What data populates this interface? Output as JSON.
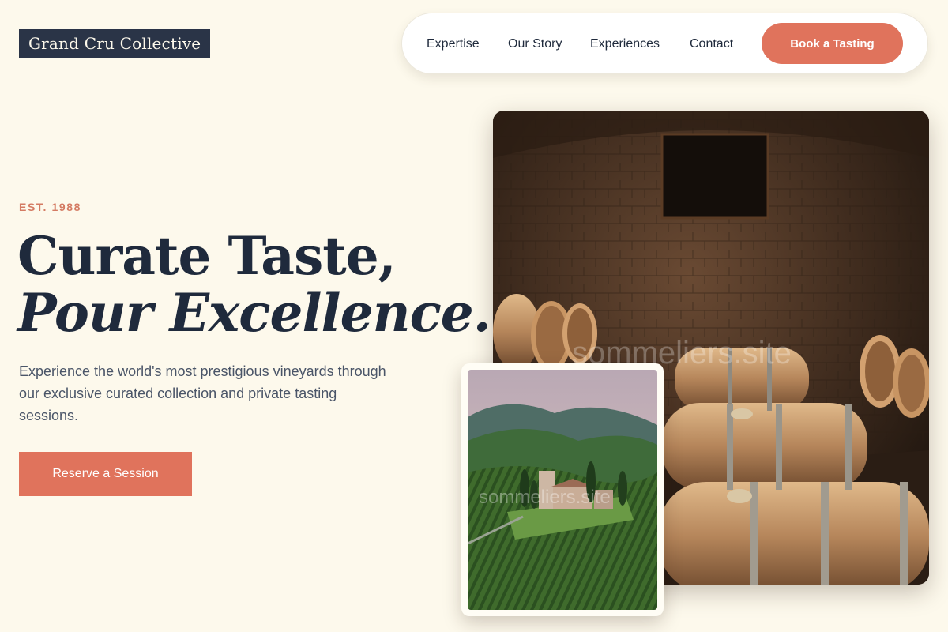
{
  "brand": {
    "name": "Grand Cru Collective"
  },
  "nav": {
    "links": [
      "Expertise",
      "Our Story",
      "Experiences",
      "Contact"
    ],
    "cta_label": "Book a Tasting"
  },
  "hero": {
    "eyebrow": "EST. 1988",
    "headline_line1": "Curate Taste,",
    "headline_line2": "Pour Excellence.",
    "lead": "Experience the world's most prestigious vineyards through our exclusive curated collection and private tasting sessions.",
    "cta_label": "Reserve a Session"
  },
  "images": {
    "watermark": "sommeliers.site"
  },
  "colors": {
    "background": "#fdf9ec",
    "ink": "#1f2a3c",
    "accent": "#e0735c",
    "logo_bg": "#2a3447"
  }
}
